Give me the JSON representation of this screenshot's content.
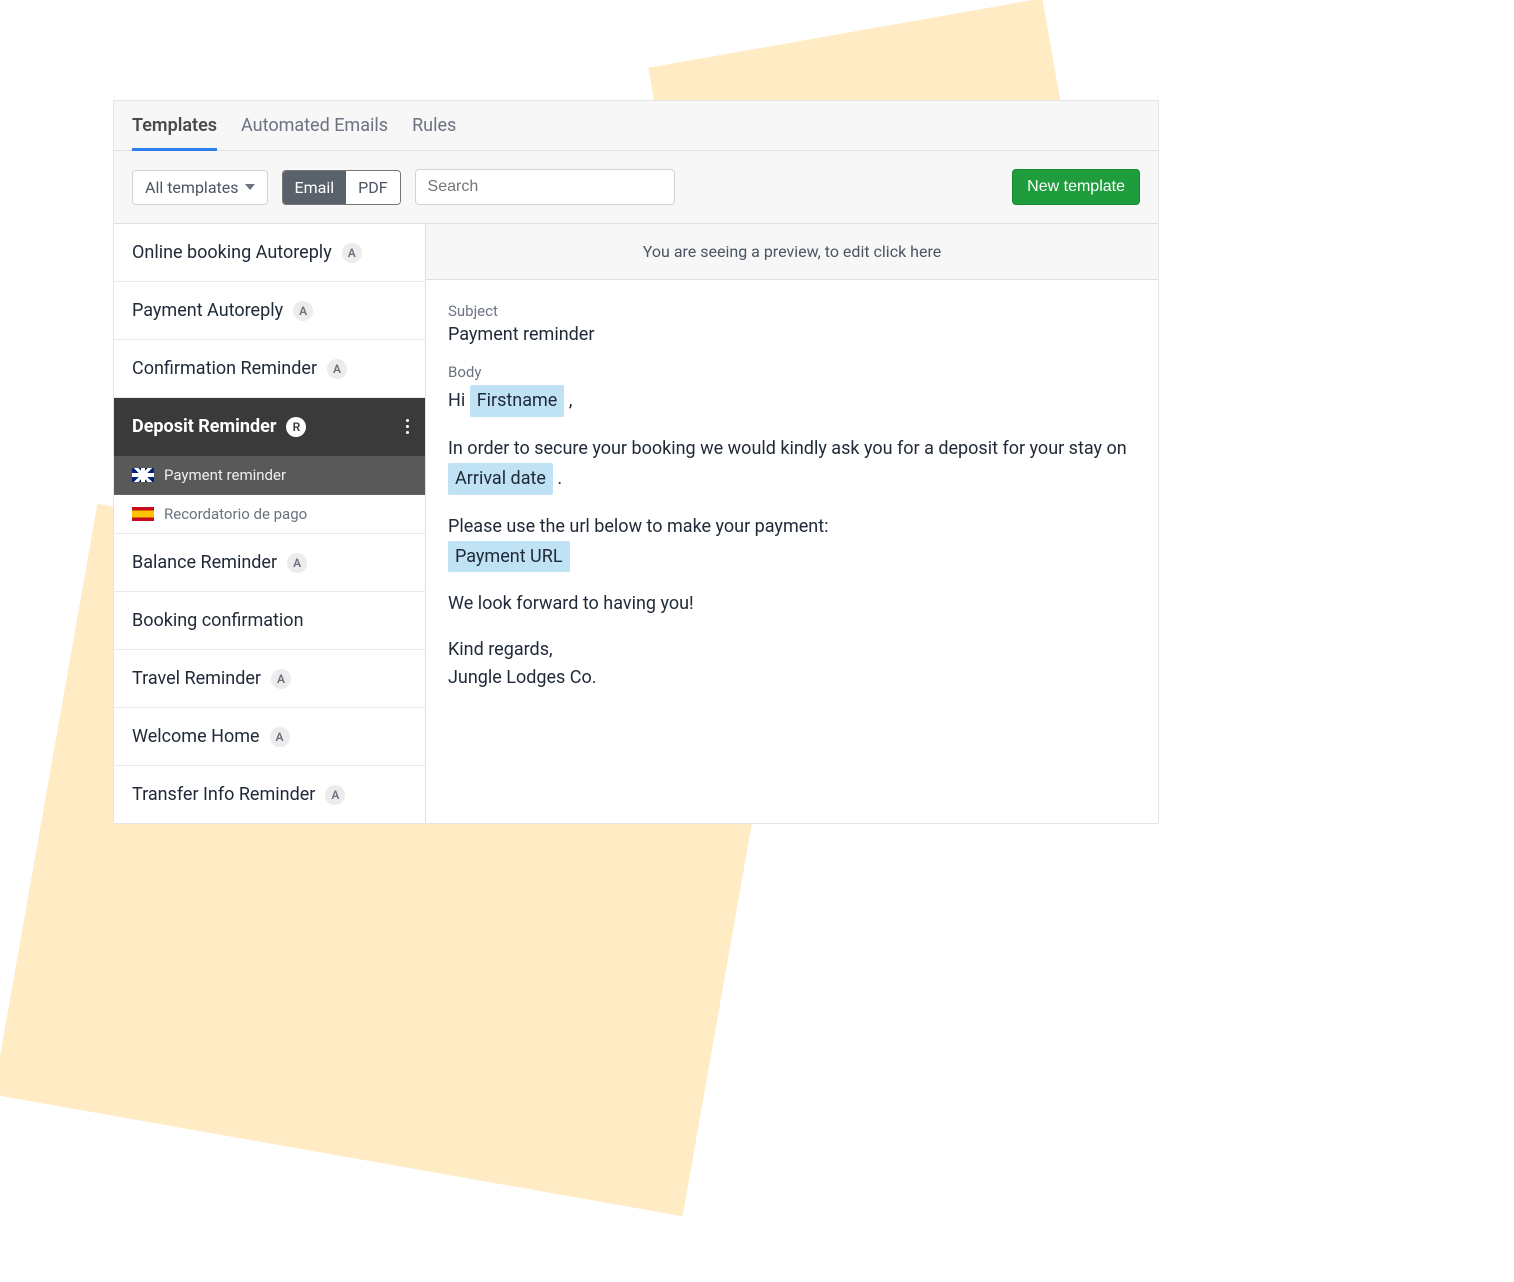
{
  "tabs": {
    "templates": "Templates",
    "automated": "Automated Emails",
    "rules": "Rules",
    "active": "templates"
  },
  "toolbar": {
    "filter_label": "All templates",
    "seg_email": "Email",
    "seg_pdf": "PDF",
    "seg_active": "email",
    "search_placeholder": "Search",
    "new_template": "New template"
  },
  "sidebar": {
    "items": [
      {
        "label": "Online booking Autoreply",
        "badge": "A"
      },
      {
        "label": "Payment Autoreply",
        "badge": "A"
      },
      {
        "label": "Confirmation Reminder",
        "badge": "A"
      },
      {
        "label": "Deposit Reminder",
        "badge": "R",
        "active": true,
        "langs": [
          {
            "flag": "uk",
            "text": "Payment reminder",
            "selected": true
          },
          {
            "flag": "es",
            "text": "Recordatorio de pago"
          }
        ]
      },
      {
        "label": "Balance Reminder",
        "badge": "A"
      },
      {
        "label": "Booking confirmation"
      },
      {
        "label": "Travel Reminder",
        "badge": "A"
      },
      {
        "label": "Welcome Home",
        "badge": "A"
      },
      {
        "label": "Transfer Info Reminder",
        "badge": "A"
      }
    ]
  },
  "preview": {
    "notice": "You are seeing a preview, to edit click here",
    "subject_label": "Subject",
    "subject_value": "Payment reminder",
    "body_label": "Body",
    "greeting_pre": "Hi ",
    "token_firstname": "Firstname",
    "greeting_post": " ,",
    "para1_pre": "In order to secure your booking we would kindly ask you for a deposit for your stay on ",
    "token_arrival": "Arrival date",
    "para1_post": " .",
    "para2": "Please use the url below to make your payment:",
    "token_payment_url": "Payment URL",
    "para3": "We look forward to having you!",
    "signoff1": "Kind regards,",
    "signoff2": "Jungle Lodges Co."
  }
}
